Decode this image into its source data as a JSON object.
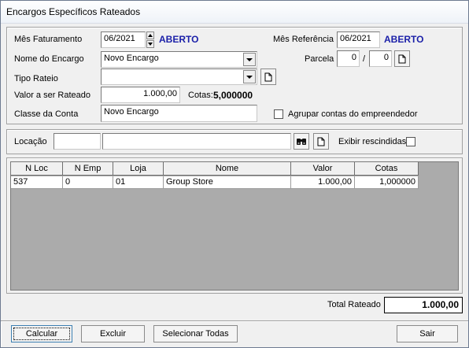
{
  "window": {
    "title": "Encargos Específicos Rateados"
  },
  "form": {
    "mes_faturamento_label": "Mês Faturamento",
    "mes_faturamento_value": "06/2021",
    "mes_faturamento_status": "ABERTO",
    "mes_referencia_label": "Mês Referência",
    "mes_referencia_value": "06/2021",
    "mes_referencia_status": "ABERTO",
    "nome_encargo_label": "Nome do Encargo",
    "nome_encargo_value": "Novo Encargo",
    "parcela_label": "Parcela",
    "parcela_num": "0",
    "parcela_sep": "/",
    "parcela_total": "0",
    "tipo_rateio_label": "Tipo Rateio",
    "tipo_rateio_value": "",
    "valor_label": "Valor a ser Rateado",
    "valor_value": "1.000,00",
    "cotas_label": "Cotas:",
    "cotas_value": "5,000000",
    "classe_label": "Classe da Conta",
    "classe_value": "Novo Encargo",
    "agrupar_label": "Agrupar contas do empreendedor",
    "agrupar_checked": false
  },
  "locacao": {
    "label": "Locação",
    "code_value": "",
    "name_value": "",
    "exibir_label": "Exibir rescindidas",
    "exibir_checked": false
  },
  "grid": {
    "columns": [
      "N Loc",
      "N Emp",
      "Loja",
      "Nome",
      "Valor",
      "Cotas"
    ],
    "rows": [
      [
        "537",
        "0",
        "01",
        "Group Store",
        "1.000,00",
        "1,000000"
      ]
    ]
  },
  "total": {
    "label": "Total Rateado",
    "value": "1.000,00"
  },
  "buttons": {
    "calcular": "Calcular",
    "excluir": "Excluir",
    "selecionar": "Selecionar Todas",
    "sair": "Sair"
  }
}
